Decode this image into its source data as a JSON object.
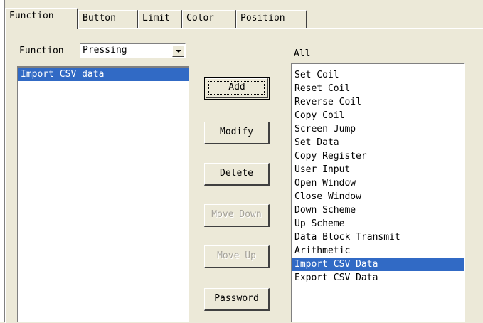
{
  "tabs": [
    {
      "label": "Function",
      "active": true
    },
    {
      "label": "Button"
    },
    {
      "label": "Limit"
    },
    {
      "label": "Color"
    },
    {
      "label": "Position"
    }
  ],
  "function_label": "Function",
  "function_combo": {
    "value": "Pressing"
  },
  "function_list": [
    {
      "label": "Import CSV data",
      "selected": true
    }
  ],
  "buttons": {
    "add": "Add",
    "modify": "Modify",
    "delete": "Delete",
    "move_down": "Move Down",
    "move_up": "Move Up",
    "password": "Password"
  },
  "all_label": "All",
  "all_list": [
    "Set Coil",
    "Reset Coil",
    "Reverse Coil",
    "Copy Coil",
    "Screen Jump",
    "Set Data",
    "Copy Register",
    "User Input",
    "Open Window",
    "Close Window",
    "Down Scheme",
    "Up Scheme",
    "Data Block Transmit",
    "Arithmetic",
    "Import CSV Data",
    "Export CSV Data"
  ],
  "all_selected": "Import CSV Data",
  "colors": {
    "face": "#ece9d8",
    "selection": "#316ac5",
    "disabled_text": "#a6a39a"
  },
  "icons": {
    "combo_dropdown": "chevron-down-icon"
  }
}
